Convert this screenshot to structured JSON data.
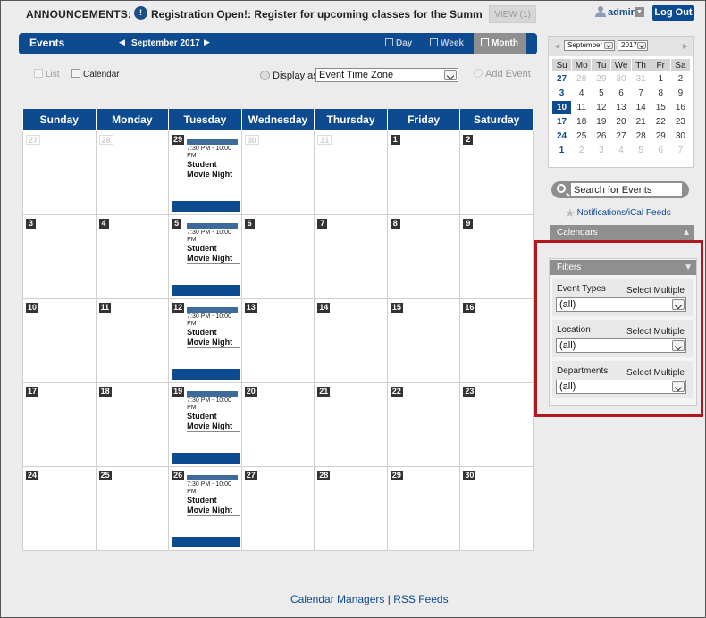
{
  "announcement": {
    "label": "ANNOUNCEMENTS:",
    "icon": "alert-icon",
    "text": "Registration Open!: Register for upcoming classes for the Summer...",
    "view_label": "VIEW (1)"
  },
  "user": {
    "name": "admin",
    "logout_label": "Log Out"
  },
  "header": {
    "title": "Events",
    "current_month": "September 2017",
    "prev_icon": "◀",
    "next_icon": "▶",
    "views": {
      "day": "Day",
      "week": "Week",
      "month": "Month"
    },
    "active_view": "Month"
  },
  "toolbar": {
    "list_label": "List",
    "calendar_label": "Calendar",
    "display_as_label": "Display as",
    "timezone_value": "Event Time Zone",
    "add_event_label": "Add Event"
  },
  "calendar": {
    "weekdays": [
      "Sunday",
      "Monday",
      "Tuesday",
      "Wednesday",
      "Thursday",
      "Friday",
      "Saturday"
    ],
    "weeks": [
      [
        {
          "d": "27",
          "o": true
        },
        {
          "d": "28",
          "o": true
        },
        {
          "d": "29",
          "ev": true
        },
        {
          "d": "30",
          "o": true
        },
        {
          "d": "31",
          "o": true
        },
        {
          "d": "1"
        },
        {
          "d": "2"
        }
      ],
      [
        {
          "d": "3"
        },
        {
          "d": "4"
        },
        {
          "d": "5",
          "ev": true
        },
        {
          "d": "6"
        },
        {
          "d": "7"
        },
        {
          "d": "8"
        },
        {
          "d": "9"
        }
      ],
      [
        {
          "d": "10"
        },
        {
          "d": "11"
        },
        {
          "d": "12",
          "ev": true
        },
        {
          "d": "13"
        },
        {
          "d": "14"
        },
        {
          "d": "15"
        },
        {
          "d": "16"
        }
      ],
      [
        {
          "d": "17"
        },
        {
          "d": "18"
        },
        {
          "d": "19",
          "ev": true
        },
        {
          "d": "20"
        },
        {
          "d": "21"
        },
        {
          "d": "22"
        },
        {
          "d": "23"
        }
      ],
      [
        {
          "d": "24"
        },
        {
          "d": "25"
        },
        {
          "d": "26",
          "ev": true
        },
        {
          "d": "27"
        },
        {
          "d": "28"
        },
        {
          "d": "29"
        },
        {
          "d": "30"
        }
      ]
    ],
    "event": {
      "time": "7:30 PM - 10:00 PM",
      "title": "Student Movie Night"
    }
  },
  "mini_calendar": {
    "month_select": "September",
    "year_select": "2017",
    "prev_icon": "◀",
    "next_icon": "▶",
    "weekdays": [
      "Su",
      "Mo",
      "Tu",
      "We",
      "Th",
      "Fr",
      "Sa"
    ],
    "weeks": [
      [
        {
          "d": "27",
          "c": "e"
        },
        {
          "d": "28",
          "c": "o"
        },
        {
          "d": "29",
          "c": "o"
        },
        {
          "d": "30",
          "c": "o"
        },
        {
          "d": "31",
          "c": "o"
        },
        {
          "d": "1"
        },
        {
          "d": "2"
        }
      ],
      [
        {
          "d": "3",
          "c": "e"
        },
        {
          "d": "4"
        },
        {
          "d": "5"
        },
        {
          "d": "6"
        },
        {
          "d": "7"
        },
        {
          "d": "8"
        },
        {
          "d": "9"
        }
      ],
      [
        {
          "d": "10",
          "c": "t"
        },
        {
          "d": "11"
        },
        {
          "d": "12"
        },
        {
          "d": "13"
        },
        {
          "d": "14"
        },
        {
          "d": "15"
        },
        {
          "d": "16"
        }
      ],
      [
        {
          "d": "17",
          "c": "e"
        },
        {
          "d": "18"
        },
        {
          "d": "19"
        },
        {
          "d": "20"
        },
        {
          "d": "21"
        },
        {
          "d": "22"
        },
        {
          "d": "23"
        }
      ],
      [
        {
          "d": "24",
          "c": "e"
        },
        {
          "d": "25"
        },
        {
          "d": "26"
        },
        {
          "d": "27"
        },
        {
          "d": "28"
        },
        {
          "d": "29"
        },
        {
          "d": "30"
        }
      ],
      [
        {
          "d": "1",
          "c": "e"
        },
        {
          "d": "2",
          "c": "o"
        },
        {
          "d": "3",
          "c": "o"
        },
        {
          "d": "4",
          "c": "o"
        },
        {
          "d": "5",
          "c": "o"
        },
        {
          "d": "6",
          "c": "o"
        },
        {
          "d": "7",
          "c": "o"
        }
      ]
    ]
  },
  "search": {
    "placeholder": "Search for Events",
    "go_label": "GO"
  },
  "notifications_label": "Notifications/iCal Feeds",
  "calendars_panel": {
    "title": "Calendars"
  },
  "filters_panel": {
    "title": "Filters",
    "groups": [
      {
        "label": "Event Types",
        "multi": "Select Multiple",
        "value": "(all)"
      },
      {
        "label": "Location",
        "multi": "Select Multiple",
        "value": "(all)"
      },
      {
        "label": "Departments",
        "multi": "Select Multiple",
        "value": "(all)"
      }
    ]
  },
  "footer": {
    "managers_label": "Calendar Managers",
    "separator": "|",
    "rss_label": "RSS Feeds"
  },
  "colors": {
    "brand_blue": "#0d4a8f",
    "highlight_red": "#b01820"
  }
}
